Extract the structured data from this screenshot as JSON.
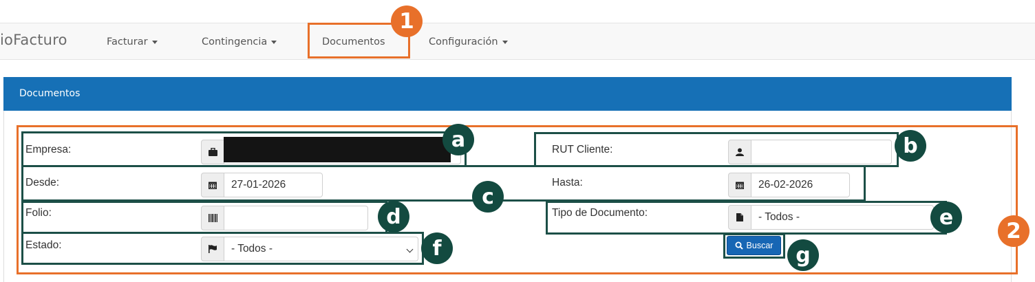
{
  "navbar": {
    "brand": "ioFacturo",
    "items": [
      {
        "label": "Facturar",
        "has_caret": true
      },
      {
        "label": "Contingencia",
        "has_caret": true
      },
      {
        "label": "Documentos",
        "has_caret": false
      },
      {
        "label": "Configuración",
        "has_caret": true
      }
    ]
  },
  "panel": {
    "title": "Documentos"
  },
  "form": {
    "empresa": {
      "label": "Empresa:",
      "icon": "briefcase-icon",
      "value": ""
    },
    "rut_cliente": {
      "label": "RUT Cliente:",
      "icon": "user-icon",
      "value": ""
    },
    "desde": {
      "label": "Desde:",
      "icon": "calendar-icon",
      "value": "27-01-2026"
    },
    "hasta": {
      "label": "Hasta:",
      "icon": "calendar-icon",
      "value": "26-02-2026"
    },
    "folio": {
      "label": "Folio:",
      "icon": "barcode-icon",
      "value": ""
    },
    "tipo_documento": {
      "label": "Tipo de Documento:",
      "icon": "file-icon",
      "value": "- Todos -"
    },
    "estado": {
      "label": "Estado:",
      "icon": "flag-icon",
      "value": "- Todos -"
    },
    "buscar": {
      "label": "Buscar",
      "icon": "search-icon"
    }
  },
  "annotations": {
    "numbers": [
      "1",
      "2"
    ],
    "letters": [
      "a",
      "b",
      "c",
      "d",
      "e",
      "f",
      "g"
    ]
  },
  "colors": {
    "primary": "#1670b6",
    "highlight_orange": "#e8702a",
    "annotation_green": "#134a40"
  }
}
